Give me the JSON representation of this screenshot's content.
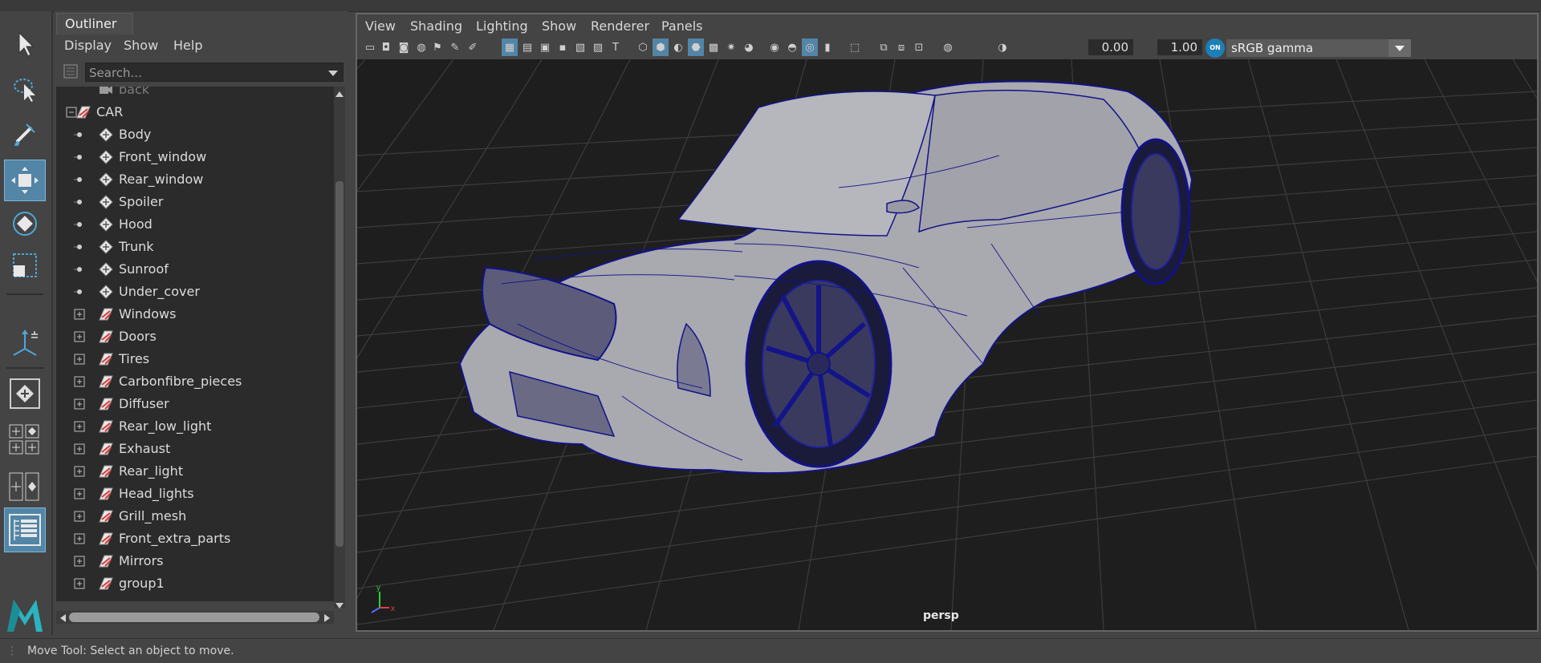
{
  "outliner": {
    "tab_title": "Outliner",
    "menu": [
      "Display",
      "Show",
      "Help"
    ],
    "search_placeholder": "Search...",
    "items": [
      {
        "label": "back",
        "type": "camera",
        "level": 2,
        "expander": "none",
        "dimmed": true
      },
      {
        "label": "CAR",
        "type": "group",
        "level": 1,
        "expander": "minus"
      },
      {
        "label": "Body",
        "type": "mesh",
        "level": 2,
        "expander": "dot"
      },
      {
        "label": "Front_window",
        "type": "mesh",
        "level": 2,
        "expander": "dot"
      },
      {
        "label": "Rear_window",
        "type": "mesh",
        "level": 2,
        "expander": "dot"
      },
      {
        "label": "Spoiler",
        "type": "mesh",
        "level": 2,
        "expander": "dot"
      },
      {
        "label": "Hood",
        "type": "mesh",
        "level": 2,
        "expander": "dot"
      },
      {
        "label": "Trunk",
        "type": "mesh",
        "level": 2,
        "expander": "dot"
      },
      {
        "label": "Sunroof",
        "type": "mesh",
        "level": 2,
        "expander": "dot"
      },
      {
        "label": "Under_cover",
        "type": "mesh",
        "level": 2,
        "expander": "dot"
      },
      {
        "label": "Windows",
        "type": "group",
        "level": 2,
        "expander": "plus"
      },
      {
        "label": "Doors",
        "type": "group",
        "level": 2,
        "expander": "plus"
      },
      {
        "label": "Tires",
        "type": "group",
        "level": 2,
        "expander": "plus"
      },
      {
        "label": "Carbonfibre_pieces",
        "type": "group",
        "level": 2,
        "expander": "plus"
      },
      {
        "label": "Diffuser",
        "type": "group",
        "level": 2,
        "expander": "plus"
      },
      {
        "label": "Rear_low_light",
        "type": "group",
        "level": 2,
        "expander": "plus"
      },
      {
        "label": "Exhaust",
        "type": "group",
        "level": 2,
        "expander": "plus"
      },
      {
        "label": "Rear_light",
        "type": "group",
        "level": 2,
        "expander": "plus"
      },
      {
        "label": "Head_lights",
        "type": "group",
        "level": 2,
        "expander": "plus"
      },
      {
        "label": "Grill_mesh",
        "type": "group",
        "level": 2,
        "expander": "plus"
      },
      {
        "label": "Front_extra_parts",
        "type": "group",
        "level": 2,
        "expander": "plus"
      },
      {
        "label": "Mirrors",
        "type": "group",
        "level": 2,
        "expander": "plus"
      },
      {
        "label": "group1",
        "type": "group",
        "level": 2,
        "expander": "plus"
      }
    ]
  },
  "viewport": {
    "menu": [
      "View",
      "Shading",
      "Lighting",
      "Show",
      "Renderer",
      "Panels"
    ],
    "exposure_value": "0.00",
    "gamma_value": "1.00",
    "color_mgmt_badge": "ON",
    "color_space": "sRGB gamma",
    "camera_label": "persp",
    "axis_labels": {
      "y": "y",
      "x": "x"
    }
  },
  "status_bar": {
    "message": "Move Tool: Select an object to move."
  },
  "colors": {
    "accent": "#5285a6",
    "wire": "#0a0a9e",
    "viewport_bg": "#1e1e1e",
    "icon_red": "#d23c3c"
  }
}
